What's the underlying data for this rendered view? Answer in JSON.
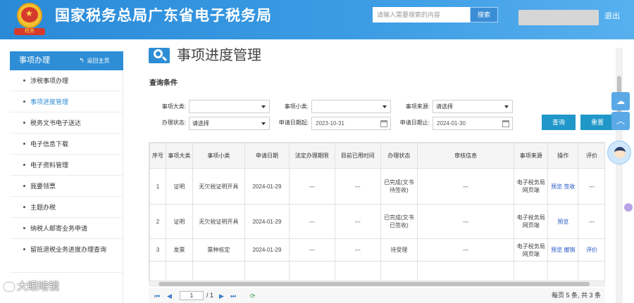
{
  "header": {
    "site_title": "国家税务总局广东省电子税务局",
    "search_placeholder": "请输入需要搜索的内容",
    "search_button": "搜索",
    "logout_label": "退出",
    "emblem_icon": "tax-emblem-icon"
  },
  "sidebar": {
    "title": "事项办理",
    "back_label": "返回主页",
    "items": [
      {
        "label": "涉税事项办理"
      },
      {
        "label": "事项进度管理",
        "active": true
      },
      {
        "label": "税务文书电子送达"
      },
      {
        "label": "电子信息下载"
      },
      {
        "label": "电子资料管理"
      },
      {
        "label": "我要领票"
      },
      {
        "label": "主题办税"
      },
      {
        "label": "纳税人邮寄业务申请"
      },
      {
        "label": "留抵退税业务进度办理查询"
      }
    ]
  },
  "main": {
    "title": "事项进度管理",
    "section_label": "查询条件",
    "filters": {
      "category_label": "事项大类:",
      "category_value": "",
      "subcategory_label": "事项小类:",
      "subcategory_value": "",
      "source_label": "事项来源:",
      "source_value": "请选择",
      "status_label": "办理状态:",
      "status_value": "请选择",
      "date_start_label": "申请日期起:",
      "date_start_value": "2023-10-31",
      "date_end_label": "申请日期止:",
      "date_end_value": "2024-01-30"
    },
    "buttons": {
      "query": "查询",
      "reset": "重置"
    },
    "table": {
      "headers": [
        "序号",
        "事项大类",
        "事项小类",
        "申请日期",
        "法定办理期限",
        "目前已用时间",
        "办理状态",
        "审核信息",
        "事项来源",
        "操作",
        "评价"
      ],
      "rows": [
        {
          "no": "1",
          "category": "证明",
          "subcategory": "无欠税证明开具",
          "date": "2024-01-29",
          "deadline": "---",
          "elapsed": "---",
          "status": "已完成(文书待签收)",
          "audit": "---",
          "source": "电子税务局网页端",
          "action1": "预览",
          "action2": "签收",
          "rating": "---"
        },
        {
          "no": "2",
          "category": "证明",
          "subcategory": "无欠税证明开具",
          "date": "2024-01-29",
          "deadline": "---",
          "elapsed": "---",
          "status": "已完成(文书已签收)",
          "audit": "---",
          "source": "电子税务局网页端",
          "action1": "预览",
          "action2": "",
          "rating": "---"
        },
        {
          "no": "3",
          "category": "发票",
          "subcategory": "票种核定",
          "date": "2024-01-29",
          "deadline": "---",
          "elapsed": "---",
          "status": "待受理",
          "audit": "---",
          "source": "电子税务局网页端",
          "action1": "预览",
          "action2": "撤销",
          "rating": "评价"
        }
      ]
    },
    "pager": {
      "current_page": "1",
      "total_pages": "/ 1",
      "summary": "每页 5 条, 共 3 条"
    }
  },
  "watermark": "大眼暗镜",
  "colors": {
    "header_blue": "#2a8ad8",
    "accent_blue": "#2d8ed6",
    "button_teal": "#1f97c9",
    "link_blue": "#2255c4"
  }
}
